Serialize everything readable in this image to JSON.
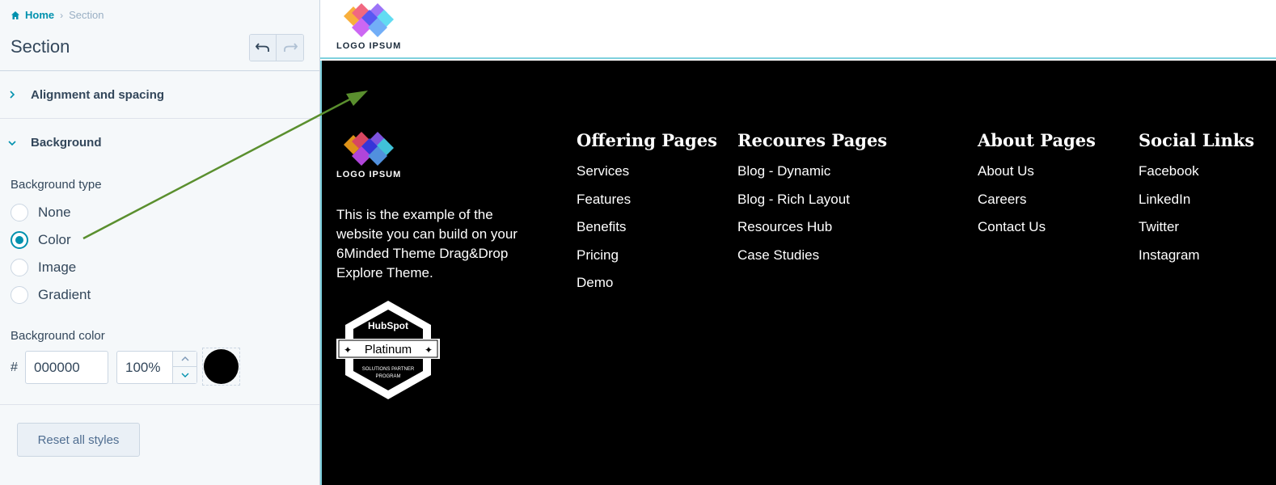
{
  "panel": {
    "breadcrumb": {
      "home": "Home",
      "separator": "›",
      "current": "Section"
    },
    "title": "Section",
    "sections": [
      {
        "label": "Alignment and spacing",
        "expanded": false
      },
      {
        "label": "Background",
        "expanded": true
      }
    ],
    "background_type": {
      "label": "Background type",
      "options": [
        "None",
        "Color",
        "Image",
        "Gradient"
      ],
      "selected": "Color"
    },
    "background_color": {
      "label": "Background color",
      "hash": "#",
      "hex": "000000",
      "opacity": "100%",
      "swatch_color": "#000000"
    },
    "reset_label": "Reset all styles"
  },
  "preview": {
    "logo_text": "LOGO IPSUM",
    "tagline": "This is the example of the website you can build on your 6Minded Theme Drag&Drop Explore Theme.",
    "badge": {
      "brand": "HubSpot",
      "tier": "Platinum",
      "line1": "SOLUTIONS PARTNER",
      "line2": "PROGRAM"
    },
    "columns": [
      {
        "title": "Offering Pages",
        "links": [
          "Services",
          "Features",
          "Benefits",
          "Pricing",
          "Demo"
        ]
      },
      {
        "title": "Recoures Pages",
        "links": [
          "Blog - Dynamic",
          "Blog - Rich Layout",
          "Resources Hub",
          "Case Studies"
        ]
      },
      {
        "title": "About Pages",
        "links": [
          "About Us",
          "Careers",
          "Contact Us"
        ]
      },
      {
        "title": "Social Links",
        "links": [
          "Facebook",
          "LinkedIn",
          "Twitter",
          "Instagram"
        ]
      }
    ],
    "footer_bg": "#000000"
  },
  "colors": {
    "accent": "#0091ae",
    "arrow": "#5a8f2e",
    "header_border": "#7fd1de"
  }
}
